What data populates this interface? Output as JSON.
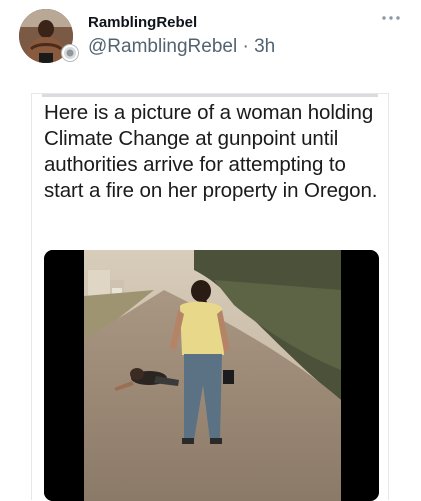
{
  "post": {
    "display_name": "RamblingRebel",
    "handle": "@RamblingRebel",
    "separator": "·",
    "time": "3h",
    "more_icon": "more-horizontal-icon",
    "badge_icon": "verified-seal-icon"
  },
  "shared_image": {
    "caption": "Here is a picture of a woman holding Climate Change at gunpoint until authorities arrive for attempting to start a fire on her property in Oregon."
  },
  "colors": {
    "name": "#0f1419",
    "handle": "#536471",
    "border": "#e6e7e9"
  }
}
